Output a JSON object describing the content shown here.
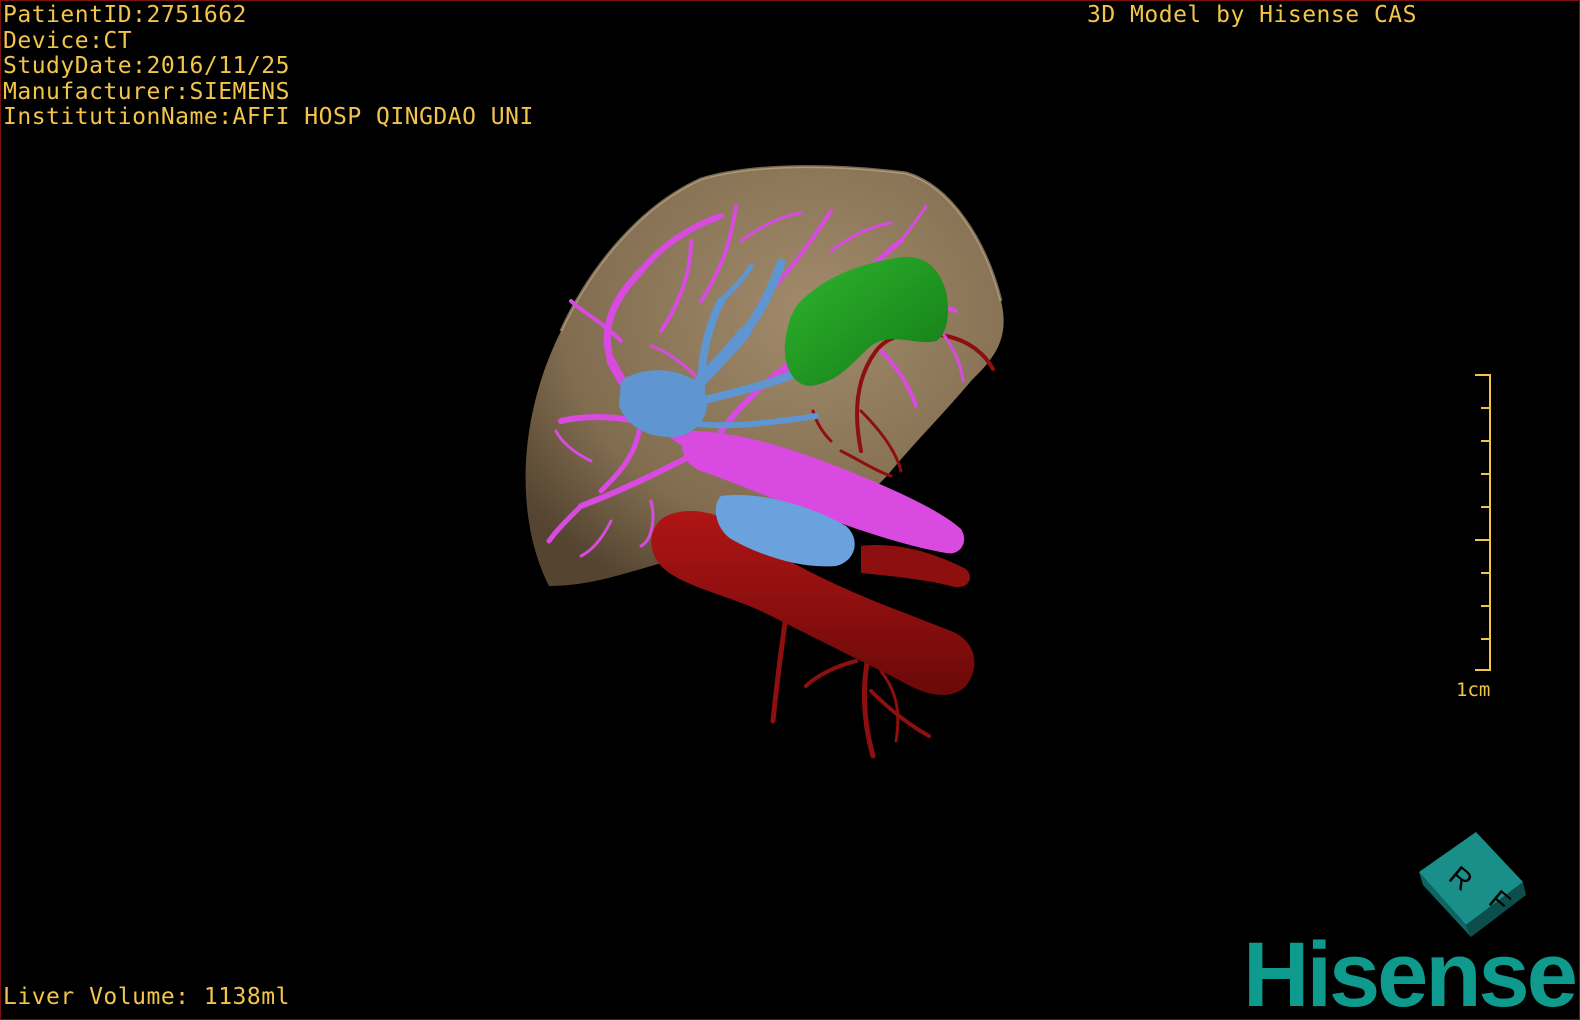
{
  "info": {
    "patient_id": "PatientID:2751662",
    "device": "Device:CT",
    "study_date": "StudyDate:2016/11/25",
    "manufacturer": "Manufacturer:SIEMENS",
    "institution": "InstitutionName:AFFI HOSP QINGDAO UNI"
  },
  "credit": "3D Model by Hisense CAS",
  "liver_volume": "Liver Volume: 1138ml",
  "scale": {
    "label": "1cm"
  },
  "orientation_cube": {
    "face_top": "R",
    "face_side": "F"
  },
  "brand": {
    "name": "Hisense"
  },
  "colors": {
    "text": "#f2c54a",
    "liver": "#9c8565",
    "portal_vein": "#d84ae0",
    "hepatic_vein": "#5f95d0",
    "gallbladder": "#1f9a22",
    "artery": "#8e0f0f",
    "brand": "#0e9b8d"
  }
}
